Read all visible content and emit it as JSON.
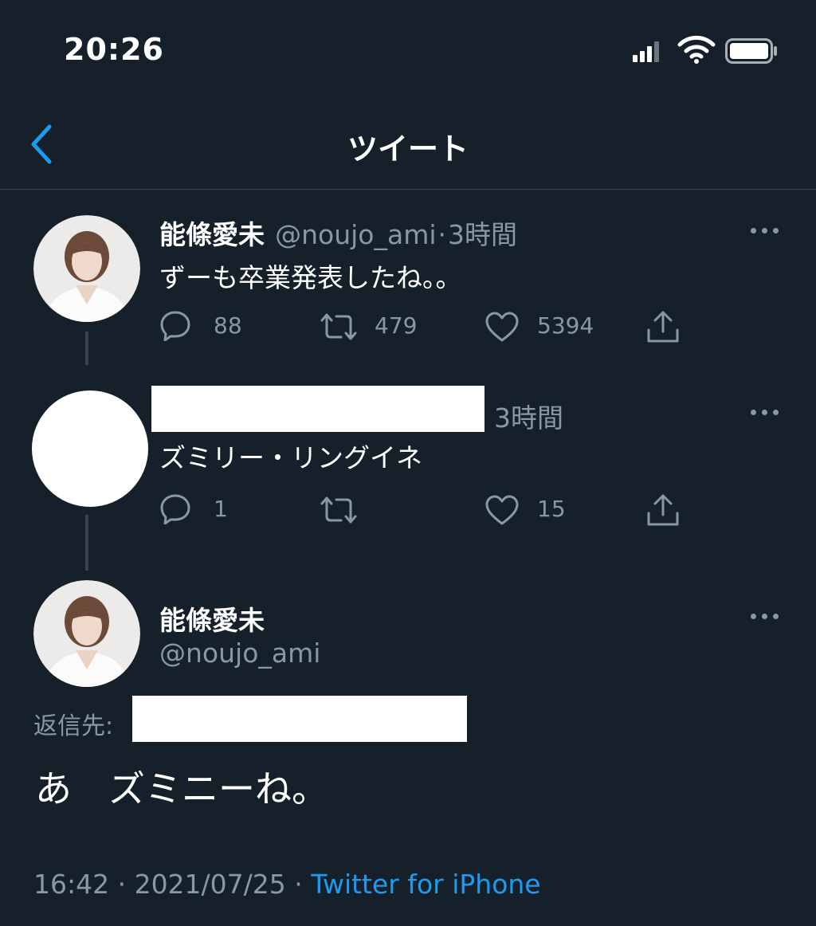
{
  "status_bar": {
    "time": "20:26"
  },
  "nav": {
    "title": "ツイート"
  },
  "tweets": [
    {
      "name": "能條愛未",
      "handle": "@noujo_ami",
      "separator": "·",
      "time": "3時間",
      "text": "ずーも卒業発表したね。。",
      "replies": "88",
      "retweets": "479",
      "likes": "5394"
    },
    {
      "time": "3時間",
      "text": "ズミリー・リングイネ",
      "replies": "1",
      "retweets": "",
      "likes": "15"
    }
  ],
  "main_tweet": {
    "name": "能條愛未",
    "handle": "@noujo_ami",
    "reply_to_label": "返信先:",
    "text": "あ　ズミニーね。",
    "timestamp": "16:42 · 2021/07/25 ·",
    "source": "Twitter for iPhone"
  },
  "colors": {
    "background": "#15202b",
    "accent": "#1d9bf0",
    "muted": "#8899a6",
    "divider": "#38444d"
  },
  "icons": [
    "back-chevron-icon",
    "reply-icon",
    "retweet-icon",
    "like-icon",
    "share-icon",
    "more-icon",
    "signal-icon",
    "wifi-icon",
    "battery-icon"
  ]
}
